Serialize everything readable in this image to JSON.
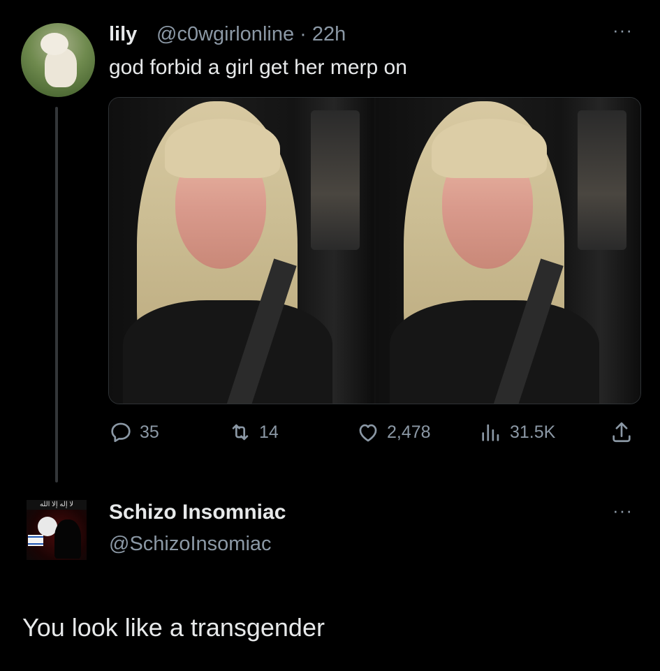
{
  "tweet": {
    "author_name": "lily",
    "author_handle": "@c0wgirlonline",
    "time_ago": "22h",
    "text": "god forbid a girl get her merp on",
    "more_label": "···",
    "stats": {
      "replies": "35",
      "retweets": "14",
      "likes": "2,478",
      "views": "31.5K"
    },
    "icons": {
      "reply": "reply-icon",
      "retweet": "retweet-icon",
      "like": "heart-icon",
      "views": "views-bar-icon",
      "share": "share-icon"
    },
    "media": [
      {
        "name": "photo-left"
      },
      {
        "name": "photo-right"
      }
    ]
  },
  "reply": {
    "author_name": "Schizo Insomniac",
    "author_handle": "@SchizoInsomiac",
    "text": "You look like a transgender",
    "more_label": "···",
    "avatar_banner_text": "لا إله إلا الله"
  },
  "colors": {
    "background": "#000000",
    "primary_text": "#e7e9ea",
    "secondary_text": "#8b98a5",
    "divider": "#2f3336"
  }
}
